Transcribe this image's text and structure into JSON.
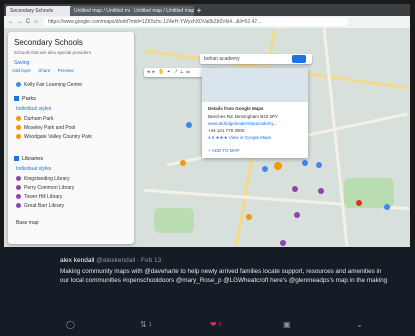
{
  "browser": {
    "tabs": [
      "Secondary Schools",
      "Untitled map / Untitled map",
      "Untitled map / Untitled map"
    ],
    "url": "https://www.google.com/maps/d/edit?mid=1ZK5chc-1Z4eH-YWyzhXDVa0kZb0Vkl4...&ll=52.47...",
    "new_tab": "+",
    "nav": [
      "←",
      "→",
      "C",
      "⌂"
    ]
  },
  "map_panel": {
    "title": "Secondary Schools",
    "subtitle": "Schools that are also special providers",
    "saving": "Saving",
    "actions": [
      "Add layer",
      "Share",
      "Preview"
    ],
    "layers": [
      {
        "name": "Kelly Fair Learning Centre",
        "items": []
      },
      {
        "name": "Parks",
        "style": "Individual styles",
        "items": [
          "Durham Park",
          "Moseley Park and Pool",
          "Woodgate Valley Country Park"
        ]
      },
      {
        "name": "Libraries",
        "style": "Individual styles",
        "items": [
          "Kingstanding Library",
          "Perry Common Library",
          "Tower Hill Library",
          "Great Barr Library"
        ]
      }
    ],
    "base_map": "Base map"
  },
  "map_search": {
    "value": "bohan academy"
  },
  "map_toolbar": {
    "tools": [
      "◂",
      "▸",
      "✋",
      "⌖",
      "↗",
      "⟂",
      "▭"
    ]
  },
  "popup": {
    "title": "Details from Google Maps",
    "lines": [
      "Beeches Rd, Birmingham B42 2PY",
      "www.aldridgeleadershipacademy...",
      "+44 121 779 3000",
      "4.6 ★★★ View in Google Maps"
    ],
    "footer": "+ ADD TO MAP"
  },
  "tweet": {
    "name": "alex kendall",
    "handle": "@alexkendall",
    "date": "· Feb 13",
    "text": "Making community maps with @daveharte to help newly arrived families locate support, resources and amenities in our local communities #openschooldoors @mary_Rose_p @LGWheatcroft here's @glenmeadps's map in the making",
    "retweets": "1",
    "likes": "5"
  },
  "icons": {
    "reply": "reply-icon",
    "retweet": "retweet-icon",
    "like": "heart-icon",
    "dm": "message-icon",
    "more": "chevron-down-icon"
  },
  "colors": {
    "tweet_bg": "#141d26",
    "like": "#e0245e",
    "accent": "#1a73e8"
  }
}
